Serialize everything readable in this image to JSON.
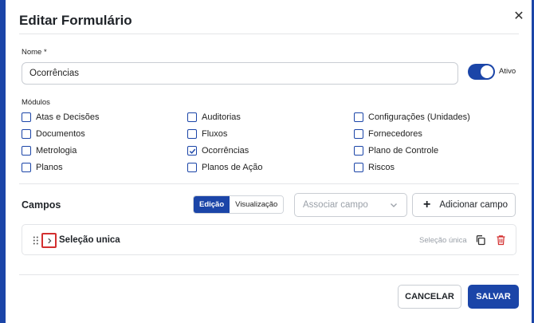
{
  "dialog": {
    "title": "Editar Formulário",
    "close_icon": "close-icon"
  },
  "name_field": {
    "label": "Nome *",
    "value": "Ocorrências"
  },
  "status_toggle": {
    "label": "Ativo",
    "on": true
  },
  "modules": {
    "label": "Módulos",
    "items": [
      {
        "label": "Atas e Decisões",
        "checked": false
      },
      {
        "label": "Auditorias",
        "checked": false
      },
      {
        "label": "Configurações (Unidades)",
        "checked": false
      },
      {
        "label": "Documentos",
        "checked": false
      },
      {
        "label": "Fluxos",
        "checked": false
      },
      {
        "label": "Fornecedores",
        "checked": false
      },
      {
        "label": "Metrologia",
        "checked": false
      },
      {
        "label": "Ocorrências",
        "checked": true
      },
      {
        "label": "Plano de Controle",
        "checked": false
      },
      {
        "label": "Planos",
        "checked": false
      },
      {
        "label": "Planos de Ação",
        "checked": false
      },
      {
        "label": "Riscos",
        "checked": false
      }
    ]
  },
  "fields_section": {
    "title": "Campos",
    "view_modes": [
      "Edição",
      "Visualização"
    ],
    "active_mode": "Edição",
    "associate_placeholder": "Associar campo",
    "add_label": "Adicionar campo",
    "items": [
      {
        "name": "Seleção unica",
        "type": "Seleção única"
      }
    ]
  },
  "footer": {
    "cancel_label": "CANCELAR",
    "save_label": "SALVAR"
  },
  "colors": {
    "accent": "#1b45a8",
    "danger": "#d32f2f",
    "muted": "#9aa0a8"
  }
}
